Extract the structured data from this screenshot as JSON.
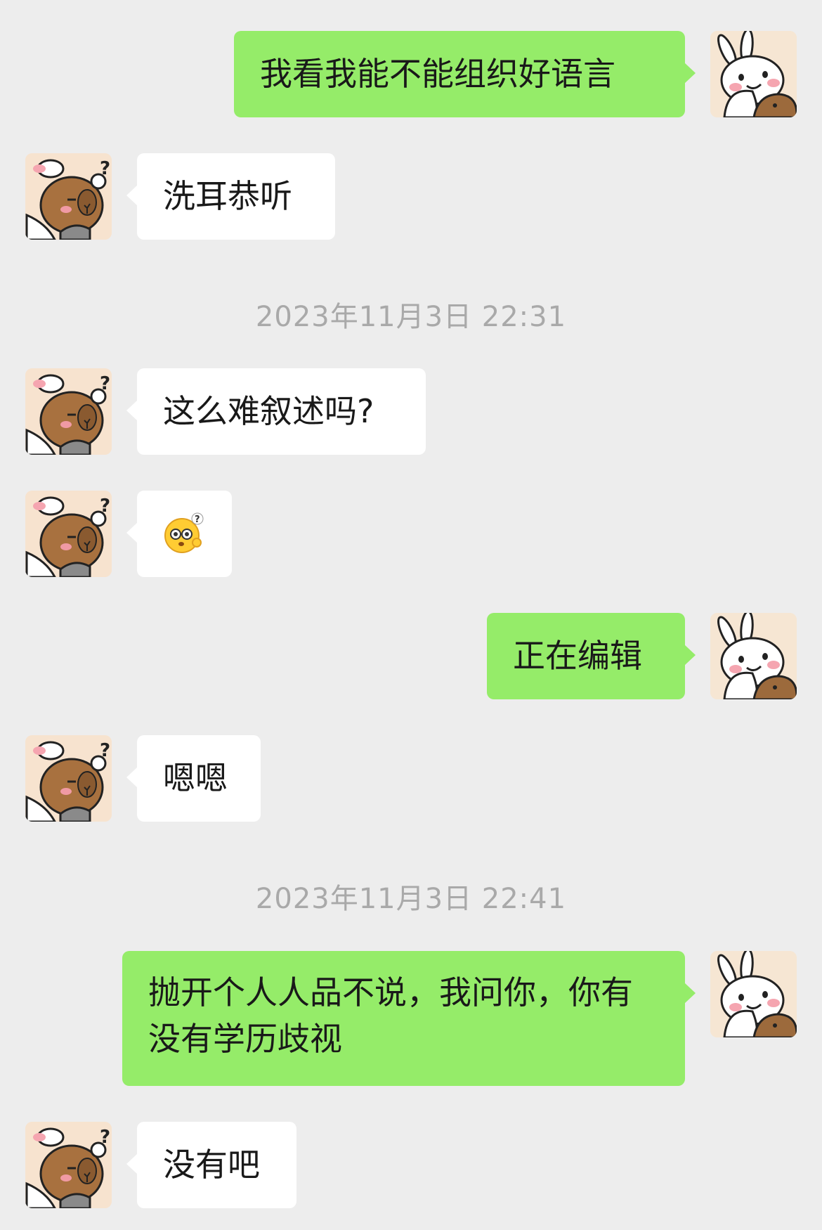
{
  "messages": [
    {
      "type": "out",
      "text": "我看我能不能组织好语言"
    },
    {
      "type": "in",
      "text": "洗耳恭听"
    },
    {
      "type": "timestamp",
      "text": "2023年11月3日 22:31"
    },
    {
      "type": "in",
      "text": "这么难叙述吗?"
    },
    {
      "type": "in",
      "emoji": "confused-face-emoji"
    },
    {
      "type": "out",
      "text": "正在编辑"
    },
    {
      "type": "in",
      "text": "嗯嗯"
    },
    {
      "type": "timestamp",
      "text": "2023年11月3日 22:41"
    },
    {
      "type": "out",
      "text": "抛开个人人品不说，我问你，你有没有学历歧视"
    },
    {
      "type": "in",
      "text": "没有吧"
    }
  ],
  "avatars": {
    "me": "bunny-capybara-avatar-icon",
    "contact": "capybara-question-avatar-icon"
  },
  "colors": {
    "background": "#ededed",
    "outgoing_bubble": "#95ec69",
    "incoming_bubble": "#ffffff",
    "timestamp_text": "#a9a9a9"
  }
}
